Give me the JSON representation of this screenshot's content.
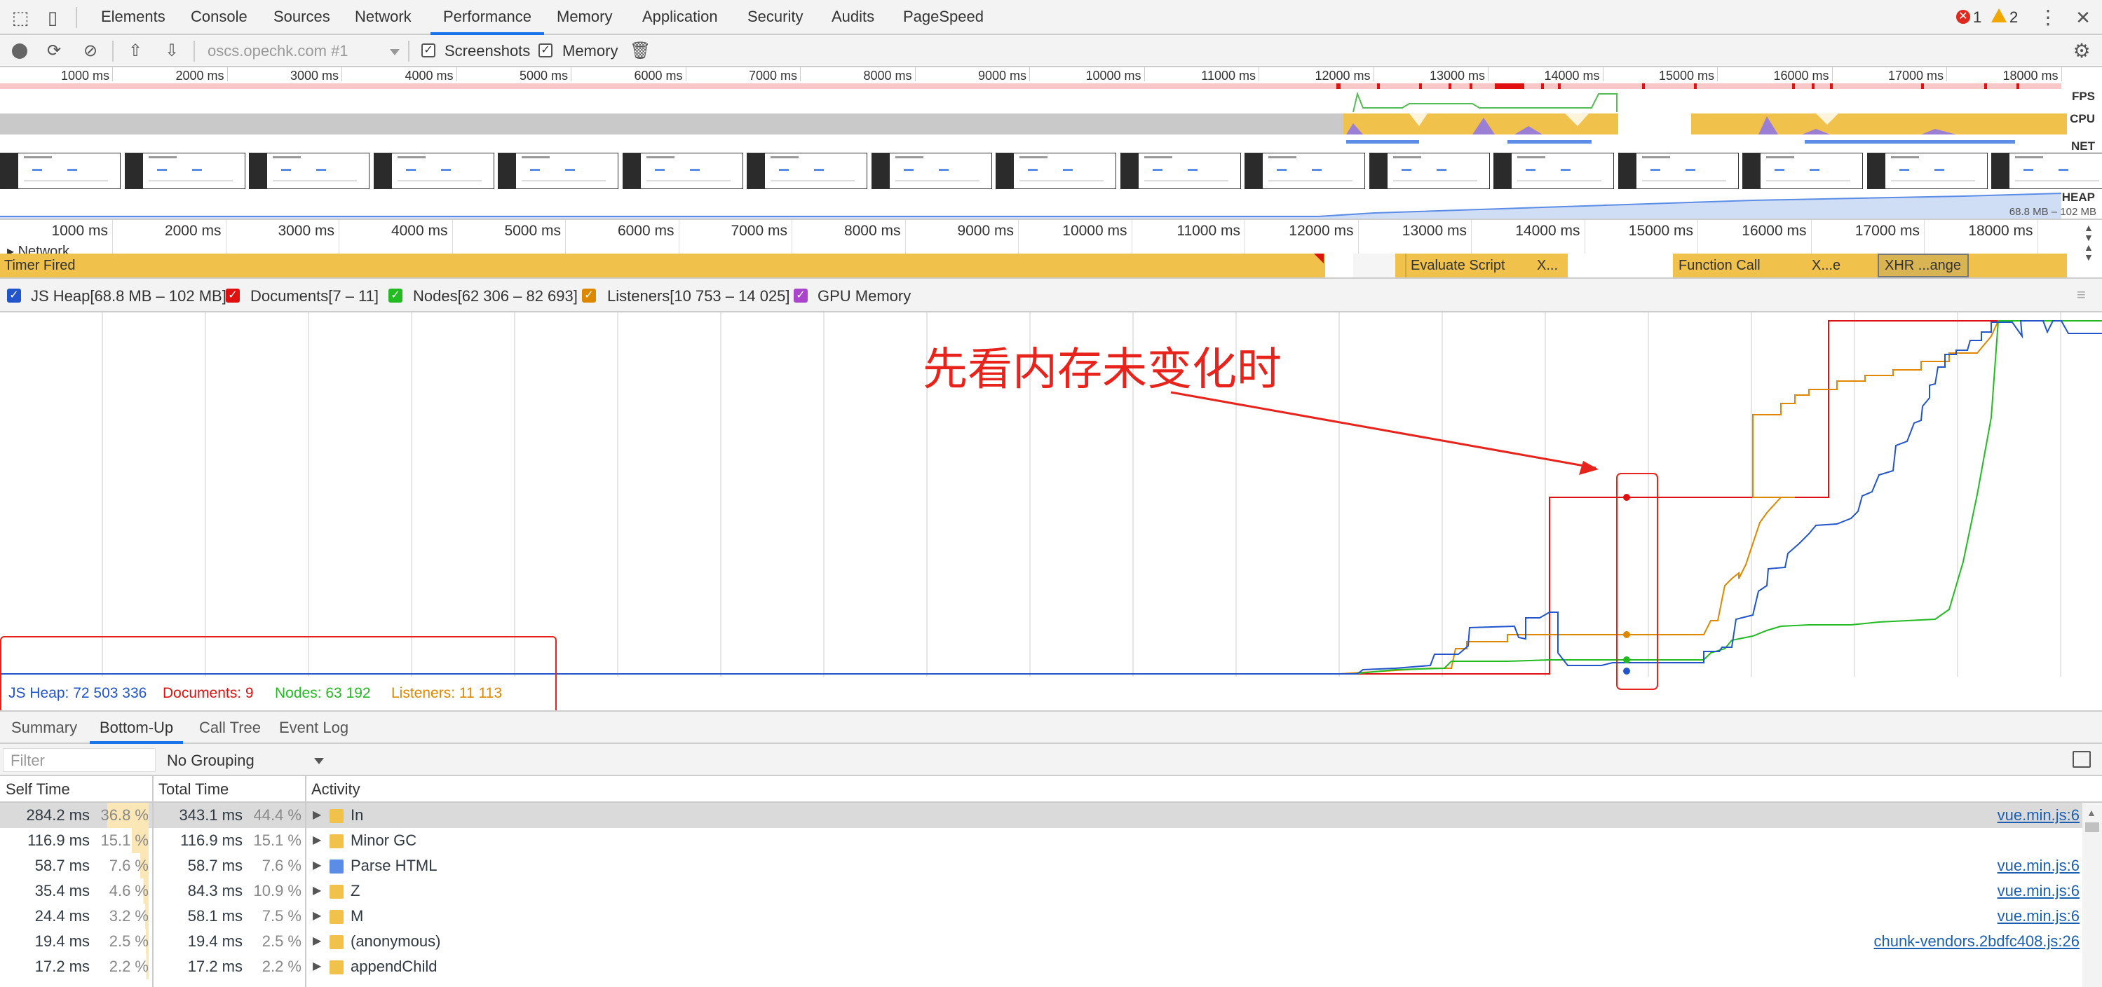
{
  "tabs": [
    "Elements",
    "Console",
    "Sources",
    "Network",
    "Performance",
    "Memory",
    "Application",
    "Security",
    "Audits",
    "PageSpeed"
  ],
  "active_tab": "Performance",
  "errors_count": "1",
  "warnings_count": "2",
  "toolbar": {
    "url_select": "oscs.opechk.com #1",
    "screenshots_label": "Screenshots",
    "memory_label": "Memory"
  },
  "overview": {
    "ticks": [
      "1000 ms",
      "2000 ms",
      "3000 ms",
      "4000 ms",
      "5000 ms",
      "6000 ms",
      "7000 ms",
      "8000 ms",
      "9000 ms",
      "10000 ms",
      "11000 ms",
      "12000 ms",
      "13000 ms",
      "14000 ms",
      "15000 ms",
      "16000 ms",
      "17000 ms",
      "18000 ms"
    ],
    "fps_label": "FPS",
    "cpu_label": "CPU",
    "net_label": "NET",
    "heap_label": "HEAP",
    "heap_range": "68.8 MB – 102 MB"
  },
  "timeline": {
    "ticks": [
      "1000 ms",
      "2000 ms",
      "3000 ms",
      "4000 ms",
      "5000 ms",
      "6000 ms",
      "7000 ms",
      "8000 ms",
      "9000 ms",
      "10000 ms",
      "11000 ms",
      "12000 ms",
      "13000 ms",
      "14000 ms",
      "15000 ms",
      "16000 ms",
      "17000 ms",
      "18000 ms"
    ],
    "network_label": "Network",
    "timer_fired": "Timer Fired",
    "evaluate_script": "Evaluate Script",
    "x1": "X...",
    "function_call": "Function Call",
    "xe": "X...e",
    "xhr": "XHR ...ange"
  },
  "legend": {
    "js_heap": "JS Heap[68.8 MB – 102 MB]",
    "documents": "Documents[7 – 11]",
    "nodes": "Nodes[62 306 – 82 693]",
    "listeners": "Listeners[10 753 – 14 025]",
    "gpu": "GPU Memory"
  },
  "colors": {
    "js_heap": "#2255cc",
    "documents": "#e01010",
    "nodes": "#22bb22",
    "listeners": "#dd8800",
    "gpu": "#aa44cc",
    "annotation": "#e8231c"
  },
  "annotation_text": "先看内存未变化时",
  "readout": {
    "js_heap": "JS Heap: 72 503 336",
    "documents": "Documents: 9",
    "nodes": "Nodes: 63 192",
    "listeners": "Listeners: 11 113"
  },
  "bottom_tabs": [
    "Summary",
    "Bottom-Up",
    "Call Tree",
    "Event Log"
  ],
  "active_bottom_tab": "Bottom-Up",
  "filter": {
    "placeholder": "Filter",
    "grouping": "No Grouping"
  },
  "columns": {
    "self": "Self Time",
    "total": "Total Time",
    "activity": "Activity"
  },
  "rows": [
    {
      "self": "284.2 ms",
      "self_pct": "36.8 %",
      "total": "343.1 ms",
      "total_pct": "44.4 %",
      "activity": "In",
      "color": "#f0c14b",
      "link": "vue.min.js:6",
      "selected": true
    },
    {
      "self": "116.9 ms",
      "self_pct": "15.1 %",
      "total": "116.9 ms",
      "total_pct": "15.1 %",
      "activity": "Minor GC",
      "color": "#f0c14b",
      "link": ""
    },
    {
      "self": "58.7 ms",
      "self_pct": "7.6 %",
      "total": "58.7 ms",
      "total_pct": "7.6 %",
      "activity": "Parse HTML",
      "color": "#5b8de6",
      "link": "vue.min.js:6"
    },
    {
      "self": "35.4 ms",
      "self_pct": "4.6 %",
      "total": "84.3 ms",
      "total_pct": "10.9 %",
      "activity": "Z",
      "color": "#f0c14b",
      "link": "vue.min.js:6"
    },
    {
      "self": "24.4 ms",
      "self_pct": "3.2 %",
      "total": "58.1 ms",
      "total_pct": "7.5 %",
      "activity": "M",
      "color": "#f0c14b",
      "link": "vue.min.js:6"
    },
    {
      "self": "19.4 ms",
      "self_pct": "2.5 %",
      "total": "19.4 ms",
      "total_pct": "2.5 %",
      "activity": "(anonymous)",
      "color": "#f0c14b",
      "link": "chunk-vendors.2bdfc408.js:26"
    },
    {
      "self": "17.2 ms",
      "self_pct": "2.2 %",
      "total": "17.2 ms",
      "total_pct": "2.2 %",
      "activity": "appendChild",
      "color": "#f0c14b",
      "link": ""
    }
  ]
}
